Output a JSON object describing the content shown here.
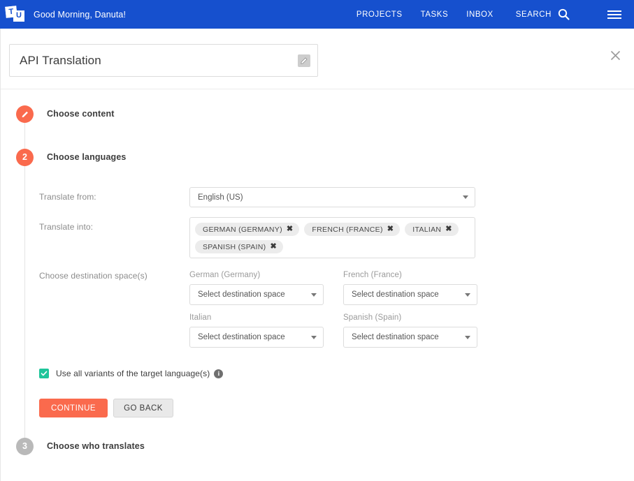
{
  "topbar": {
    "logo_letters": [
      "T",
      "U"
    ],
    "greeting": "Good Morning, Danuta!",
    "nav": [
      {
        "label": "PROJECTS"
      },
      {
        "label": "TASKS"
      },
      {
        "label": "INBOX"
      }
    ],
    "search_label": "SEARCH",
    "search_icon": "search-icon",
    "menu_icon": "hamburger-menu-icon",
    "background_color": "#1650ce"
  },
  "project": {
    "title": "API Translation",
    "edit_icon": "pencil-edit-icon",
    "close_icon": "close-icon"
  },
  "steps": [
    {
      "number": "",
      "icon": "pencil-edit-icon",
      "label": "Choose content",
      "state": "done"
    },
    {
      "number": "2",
      "icon": "",
      "label": "Choose languages",
      "state": "active"
    },
    {
      "number": "3",
      "icon": "",
      "label": "Choose who translates",
      "state": "inactive"
    }
  ],
  "form": {
    "translate_from": {
      "label": "Translate from:",
      "value": "English (US)",
      "caret_icon": "chevron-down-icon"
    },
    "translate_into": {
      "label": "Translate into:",
      "tags": [
        {
          "label": "GERMAN (GERMANY)",
          "remove_icon": "remove-tag-icon"
        },
        {
          "label": "FRENCH (FRANCE)",
          "remove_icon": "remove-tag-icon"
        },
        {
          "label": "ITALIAN",
          "remove_icon": "remove-tag-icon"
        },
        {
          "label": "SPANISH (SPAIN)",
          "remove_icon": "remove-tag-icon"
        }
      ]
    },
    "destination": {
      "label": "Choose destination space(s)",
      "spaces": [
        {
          "language": "German (Germany)",
          "value": "Select destination space"
        },
        {
          "language": "French (France)",
          "value": "Select destination space"
        },
        {
          "language": "Italian",
          "value": "Select destination space"
        },
        {
          "language": "Spanish (Spain)",
          "value": "Select destination space"
        }
      ]
    },
    "variants_checkbox": {
      "label": "Use all variants of the target language(s)",
      "checked": true,
      "check_icon": "checkmark-icon",
      "info_icon": "info-icon",
      "color": "#1ec59a"
    },
    "buttons": {
      "continue": "CONTINUE",
      "go_back": "GO BACK",
      "primary_color": "#fa6a4d"
    }
  }
}
